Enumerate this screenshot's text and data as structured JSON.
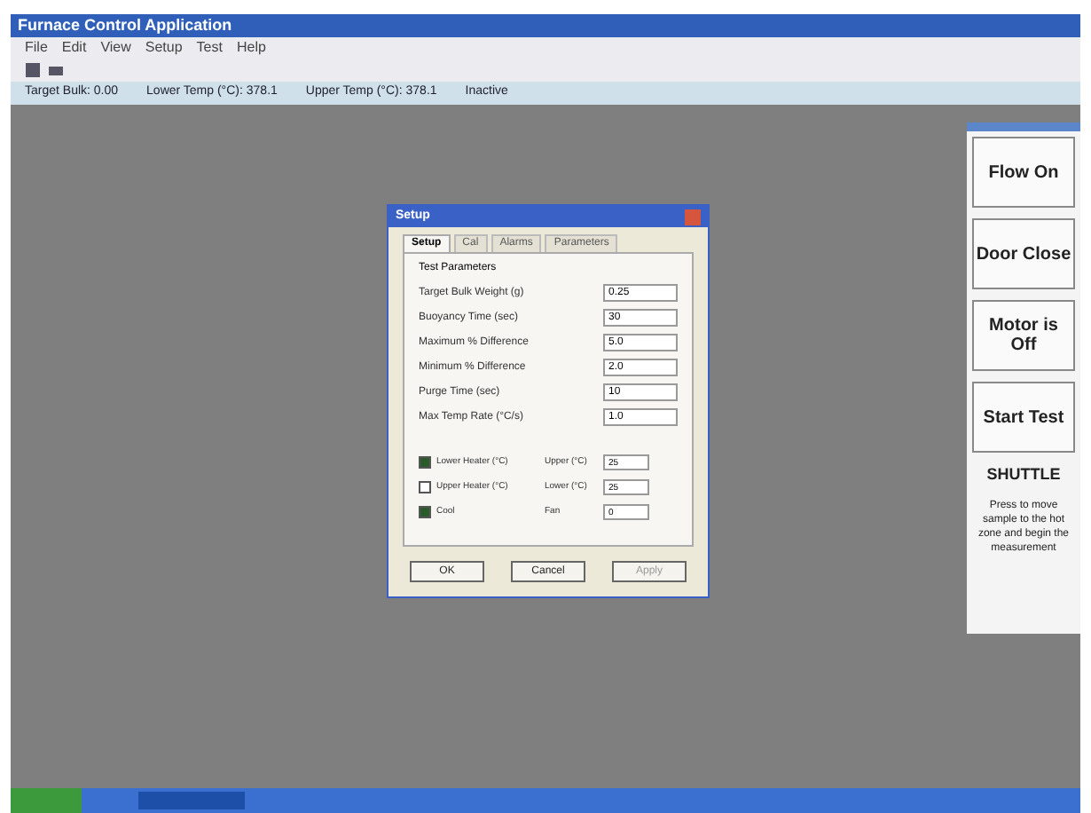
{
  "window": {
    "title": "Furnace Control Application"
  },
  "menu": [
    "File",
    "Edit",
    "View",
    "Setup",
    "Test",
    "Help"
  ],
  "info_bar": [
    "Target Bulk: 0.00",
    "Lower Temp (°C): 378.1",
    "Upper Temp (°C): 378.1",
    "Inactive"
  ],
  "dialog": {
    "title": "Setup",
    "tabs": [
      {
        "label": "Setup",
        "selected": true
      },
      {
        "label": "Cal",
        "selected": false
      },
      {
        "label": "Alarms",
        "selected": false
      },
      {
        "label": "Parameters",
        "selected": false
      }
    ],
    "group": "Test Parameters",
    "fields": [
      {
        "label": "Target Bulk Weight (g)",
        "value": "0.25"
      },
      {
        "label": "Buoyancy Time (sec)",
        "value": "30"
      },
      {
        "label": "Maximum % Difference",
        "value": "5.0"
      },
      {
        "label": "Minimum % Difference",
        "value": "2.0"
      },
      {
        "label": "Purge Time (sec)",
        "value": "10"
      },
      {
        "label": "Max Temp Rate (°C/s)",
        "value": "1.0"
      }
    ],
    "options": [
      {
        "label": "Lower Heater (°C)",
        "label2": "Upper (°C)",
        "value": "25",
        "checked": true
      },
      {
        "label": "Upper Heater (°C)",
        "label2": "Lower (°C)",
        "value": "25",
        "checked": false
      },
      {
        "label": "Cool",
        "label2": "Fan",
        "value": "0",
        "checked": true
      }
    ],
    "buttons": [
      "OK",
      "Cancel",
      "Apply"
    ]
  },
  "side_panel": {
    "buttons": [
      "Flow On",
      "Door Close",
      "Motor is Off",
      "Start Test"
    ],
    "note_title": "SHUTTLE",
    "note": "Press to move sample to the hot zone and begin the measurement"
  }
}
